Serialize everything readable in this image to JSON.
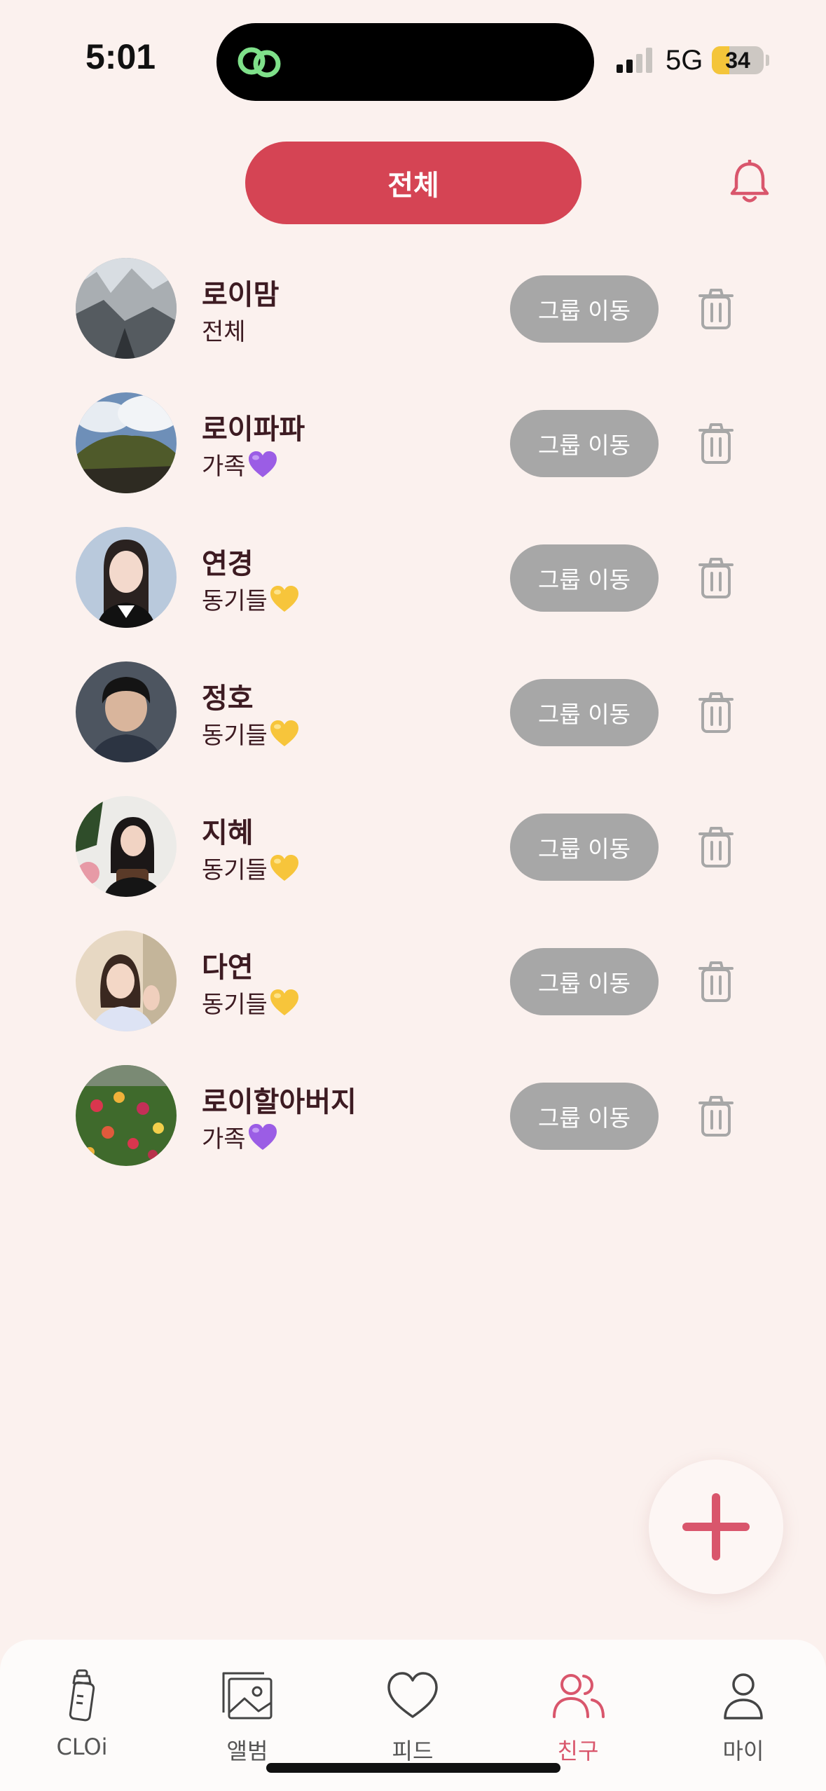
{
  "status_bar": {
    "time": "5:01",
    "network": "5G",
    "battery": "34",
    "battery_level": 0.34
  },
  "header": {
    "filter_label": "전체"
  },
  "friend_list": {
    "move_label": "그룹 이동",
    "items": [
      {
        "name": "로이맘",
        "group": "전체",
        "heart": null
      },
      {
        "name": "로이파파",
        "group": "가족",
        "heart": "purple-heart-icon"
      },
      {
        "name": "연경",
        "group": "동기들",
        "heart": "yellow-heart-icon"
      },
      {
        "name": "정호",
        "group": "동기들",
        "heart": "yellow-heart-icon"
      },
      {
        "name": "지혜",
        "group": "동기들",
        "heart": "yellow-heart-icon"
      },
      {
        "name": "다연",
        "group": "동기들",
        "heart": "yellow-heart-icon"
      },
      {
        "name": "로이할아버지",
        "group": "가족",
        "heart": "purple-heart-icon"
      }
    ]
  },
  "tab_bar": {
    "items": [
      {
        "label": "CLOi",
        "icon": "baby-bottle-icon"
      },
      {
        "label": "앨범",
        "icon": "album-icon"
      },
      {
        "label": "피드",
        "icon": "heart-icon"
      },
      {
        "label": "친구",
        "icon": "friends-icon",
        "active": true
      },
      {
        "label": "마이",
        "icon": "person-icon"
      }
    ]
  },
  "colors": {
    "background": "#fbf1ee",
    "accent": "#d54454",
    "active_tab": "#d9566c",
    "name_text": "#3d1b22",
    "move_button": "#a7a7a7",
    "purple_heart": "#9b5de5",
    "yellow_heart": "#f7c53b"
  }
}
